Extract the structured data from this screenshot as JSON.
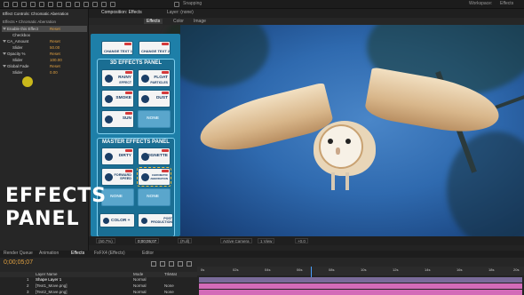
{
  "app": {
    "menu": [
      "Snapping"
    ],
    "workspace_label": "Workspace:",
    "workspace_value": "Effects"
  },
  "left_panel": {
    "tab": "Effect Controls: Chromatic Aberration",
    "subtitle": "Effects • Chromatic Aberration",
    "rows": [
      {
        "name": "Enable this Effect",
        "value": "Reset"
      },
      {
        "name": "Checkbox",
        "value": ""
      },
      {
        "name": "CA_Amount",
        "value": "Reset"
      },
      {
        "name": "Slider",
        "value": "50.00"
      },
      {
        "name": "Opacity %",
        "value": "Reset"
      },
      {
        "name": "Slider",
        "value": "100.00"
      },
      {
        "name": "Global Fade",
        "value": "Reset"
      },
      {
        "name": "Slider",
        "value": "0.00"
      }
    ]
  },
  "comp": {
    "tab": "Composition: Effects",
    "layer_tab": "Layer: (none)",
    "sub_tabs": [
      "Effects",
      "Color",
      "Image"
    ]
  },
  "effects_panel": {
    "top_buttons": [
      "CHANGE TEXT 1",
      "CHANGE TEXT 2"
    ],
    "fx3d_title": "3D EFFECTS PANEL",
    "fx3d_buttons": [
      "RAINY",
      "FLOAT",
      "SMOKE",
      "DUST",
      "SUN",
      "NONE"
    ],
    "fx3d_sub": [
      "EFFECT",
      "PARTICLES"
    ],
    "master_title": "MASTER EFFECTS PANEL",
    "master_buttons": [
      "DIRTY",
      "VIGNETTE",
      "FORWARD SPEED",
      "CHROMATIC ABERRATION",
      "NONE",
      "NONE"
    ],
    "bottom_buttons": [
      "COLOR +",
      "POST PRODUCTION"
    ]
  },
  "overlay_text": {
    "line1": "EFFECTS",
    "line2": "PANEL"
  },
  "viewer_bar": {
    "zoom": "(50.7%)",
    "timecode": "0;00;05;07",
    "resolution": "(Full)",
    "camera": "Active Camera",
    "views": "1 View",
    "exposure": "+0.0"
  },
  "timeline": {
    "tabs": [
      "Render Queue",
      "Animation",
      "Effects",
      "FxFX4 (Effects)",
      "Editor"
    ],
    "timecode": "0;00;05;07",
    "columns": [
      "Layer Name",
      "Mode",
      "TrkMat"
    ],
    "layers": [
      {
        "num": "1",
        "name": "Shape Layer 1",
        "mode": "Normal",
        "trk": ""
      },
      {
        "num": "2",
        "name": "[Text1_Move.png]",
        "mode": "Normal",
        "trk": "None"
      },
      {
        "num": "3",
        "name": "[Text2_Move.png]",
        "mode": "Normal",
        "trk": "None"
      }
    ],
    "ruler": [
      "0s",
      "02s",
      "04s",
      "06s",
      "08s",
      "10s",
      "12s",
      "14s",
      "16s",
      "18s",
      "20s"
    ]
  },
  "colors": {
    "panel_blue": "#1e7fa8",
    "accent_orange": "#e0a040",
    "track_pink": "#d36bb8"
  }
}
